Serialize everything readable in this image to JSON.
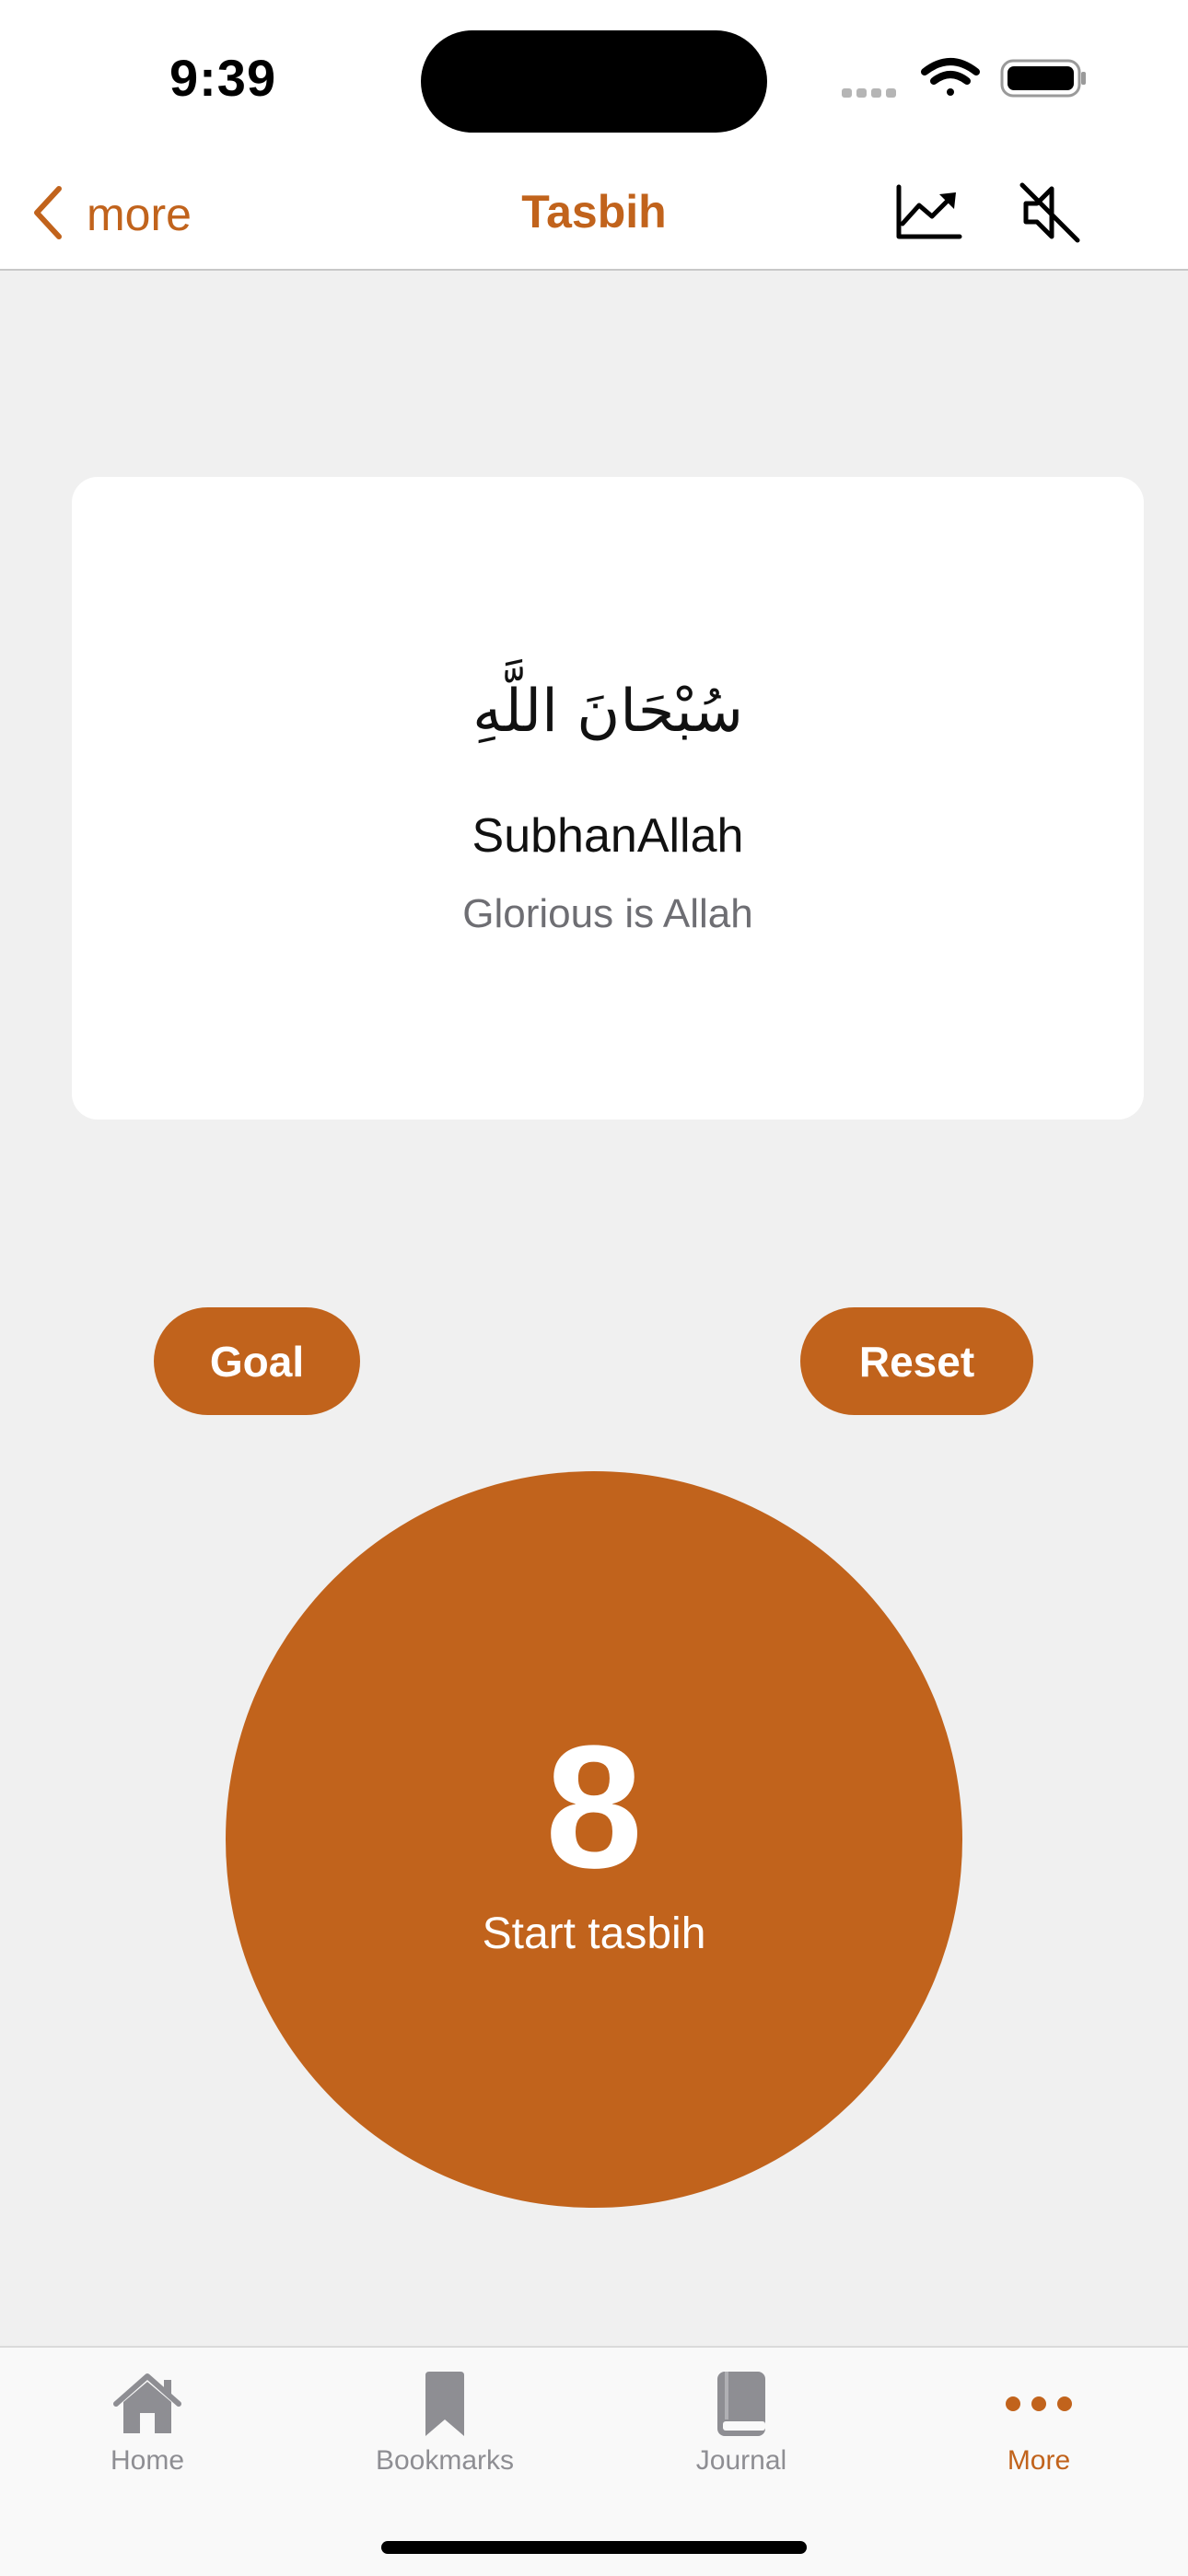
{
  "status_bar": {
    "time": "9:39"
  },
  "nav": {
    "back_label": "more",
    "title": "Tasbih",
    "icons": [
      "chart-trend-icon",
      "speaker-muted-icon"
    ]
  },
  "dhikr": {
    "arabic": "سُبْحَانَ اللَّهِ",
    "transliteration": "SubhanAllah",
    "translation": "Glorious is Allah"
  },
  "actions": {
    "goal_label": "Goal",
    "reset_label": "Reset"
  },
  "counter": {
    "count": "8",
    "label": "Start tasbih"
  },
  "tabs": [
    {
      "label": "Home",
      "icon": "home-icon",
      "active": false
    },
    {
      "label": "Bookmarks",
      "icon": "bookmark-icon",
      "active": false
    },
    {
      "label": "Journal",
      "icon": "book-icon",
      "active": false
    },
    {
      "label": "More",
      "icon": "more-dots-icon",
      "active": true
    }
  ],
  "colors": {
    "accent": "#c1631c",
    "background": "#f0f0f0",
    "card": "#ffffff",
    "inactive_tab": "#8e8e93"
  }
}
